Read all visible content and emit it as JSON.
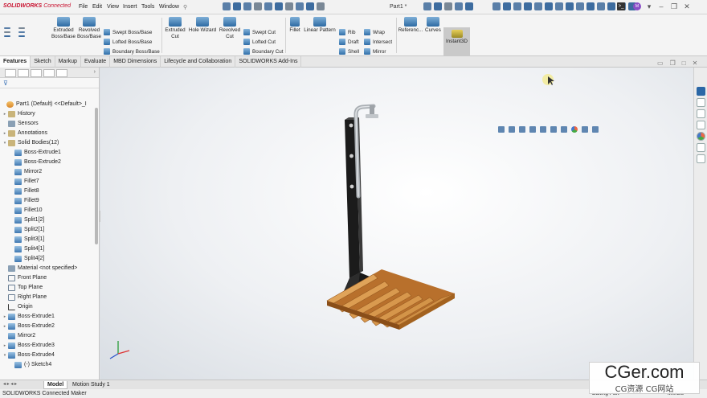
{
  "app": {
    "logo_brand": "SOLIDWORKS",
    "logo_suffix": "Connected",
    "document_title": "Part1 *",
    "menus": [
      "File",
      "Edit",
      "View",
      "Insert",
      "Tools",
      "Window"
    ],
    "avatar_initials": "M"
  },
  "commands": {
    "extruded_boss": "Extruded\nBoss/Base",
    "revolved_boss": "Revolved\nBoss/Base",
    "swept_boss": "Swept Boss/Base",
    "lofted_boss": "Lofted Boss/Base",
    "boundary_boss": "Boundary Boss/Base",
    "extruded_cut": "Extruded\nCut",
    "hole_wizard": "Hole Wizard",
    "revolved_cut": "Revolved\nCut",
    "swept_cut": "Swept Cut",
    "lofted_cut": "Lofted Cut",
    "boundary_cut": "Boundary Cut",
    "fillet": "Fillet",
    "linear_pattern": "Linear Pattern",
    "rib": "Rib",
    "draft": "Draft",
    "shell": "Shell",
    "wrap": "Wrap",
    "intersect": "Intersect",
    "mirror": "Mirror",
    "reference": "Referenc...",
    "curves": "Curves",
    "instant3d": "Instant3D"
  },
  "tabs": [
    "Features",
    "Sketch",
    "Markup",
    "Evaluate",
    "MBD Dimensions",
    "Lifecycle and Collaboration",
    "SOLIDWORKS Add-Ins"
  ],
  "feature_tree": {
    "root": "Part1 (Default) <<Default>_I",
    "items": [
      {
        "label": "History",
        "icon": "history-icon",
        "level": 1,
        "toggle": "▸"
      },
      {
        "label": "Sensors",
        "icon": "sensor-icon",
        "level": 1,
        "toggle": ""
      },
      {
        "label": "Annotations",
        "icon": "annotation-icon",
        "level": 1,
        "toggle": "▸"
      },
      {
        "label": "Solid Bodies(12)",
        "icon": "solid-bodies-folder-icon",
        "level": 1,
        "toggle": "▾"
      },
      {
        "label": "Boss-Extrude1",
        "icon": "body-icon",
        "level": 2,
        "toggle": ""
      },
      {
        "label": "Boss-Extrude2",
        "icon": "body-icon",
        "level": 2,
        "toggle": ""
      },
      {
        "label": "Mirror2",
        "icon": "body-icon",
        "level": 2,
        "toggle": ""
      },
      {
        "label": "Fillet7",
        "icon": "body-icon",
        "level": 2,
        "toggle": ""
      },
      {
        "label": "Fillet8",
        "icon": "body-icon",
        "level": 2,
        "toggle": ""
      },
      {
        "label": "Fillet9",
        "icon": "body-icon",
        "level": 2,
        "toggle": ""
      },
      {
        "label": "Fillet10",
        "icon": "body-icon",
        "level": 2,
        "toggle": ""
      },
      {
        "label": "Split1[2]",
        "icon": "body-icon",
        "level": 2,
        "toggle": ""
      },
      {
        "label": "Split2[1]",
        "icon": "body-icon",
        "level": 2,
        "toggle": ""
      },
      {
        "label": "Split3[1]",
        "icon": "body-icon",
        "level": 2,
        "toggle": ""
      },
      {
        "label": "Split4[1]",
        "icon": "body-icon",
        "level": 2,
        "toggle": ""
      },
      {
        "label": "Split4[2]",
        "icon": "body-icon",
        "level": 2,
        "toggle": ""
      },
      {
        "label": "Material <not specified>",
        "icon": "material-icon",
        "level": 1,
        "toggle": ""
      },
      {
        "label": "Front Plane",
        "icon": "plane-icon",
        "level": 1,
        "toggle": ""
      },
      {
        "label": "Top Plane",
        "icon": "plane-icon",
        "level": 1,
        "toggle": ""
      },
      {
        "label": "Right Plane",
        "icon": "plane-icon",
        "level": 1,
        "toggle": ""
      },
      {
        "label": "Origin",
        "icon": "origin-icon",
        "level": 1,
        "toggle": ""
      },
      {
        "label": "Boss-Extrude1",
        "icon": "boss-extrude-icon",
        "level": 1,
        "toggle": "▸"
      },
      {
        "label": "Boss-Extrude2",
        "icon": "boss-extrude-icon",
        "level": 1,
        "toggle": "▸"
      },
      {
        "label": "Mirror2",
        "icon": "mirror-icon",
        "level": 1,
        "toggle": ""
      },
      {
        "label": "Boss-Extrude3",
        "icon": "boss-extrude-icon",
        "level": 1,
        "toggle": "▸"
      },
      {
        "label": "Boss-Extrude4",
        "icon": "boss-extrude-icon",
        "level": 1,
        "toggle": "▾"
      },
      {
        "label": "(-) Sketch4",
        "icon": "sketch-icon",
        "level": 2,
        "toggle": ""
      }
    ]
  },
  "bottom_tabs": [
    "Model",
    "Motion Study 1"
  ],
  "status": {
    "left": "SOLIDWORKS Connected Maker",
    "editing": "Editing Part",
    "units": "MMGS"
  },
  "watermark": {
    "brand": "CGer.com",
    "subtitle": "CG资源 CG网站"
  },
  "colors": {
    "brand_red": "#c8102e",
    "accent_blue": "#2d6aa3",
    "wood": "#d68a3c",
    "post_black": "#1b1b1b"
  }
}
